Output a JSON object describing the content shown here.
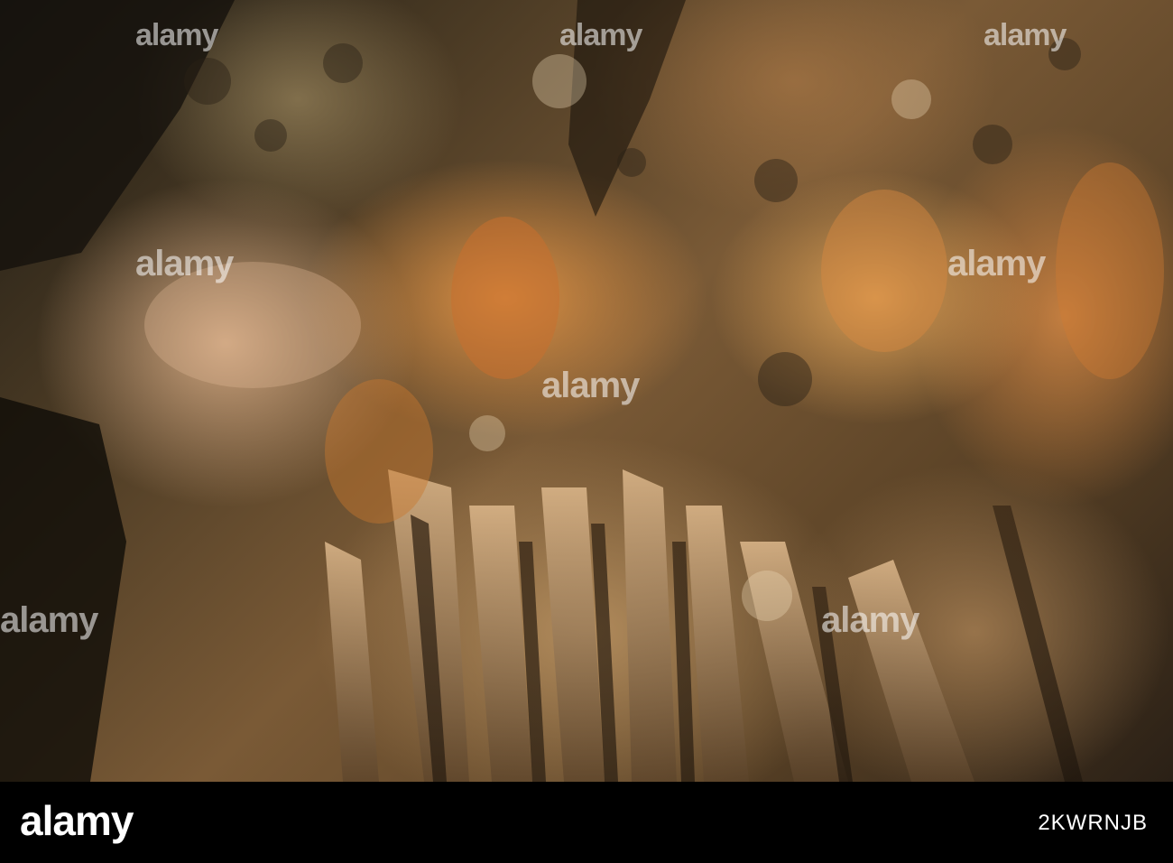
{
  "photo": {
    "subject": "cave-ceiling-formations",
    "watermark_text": "alamy"
  },
  "footer": {
    "brand": "alamy",
    "image_code": "2KWRNJB"
  }
}
